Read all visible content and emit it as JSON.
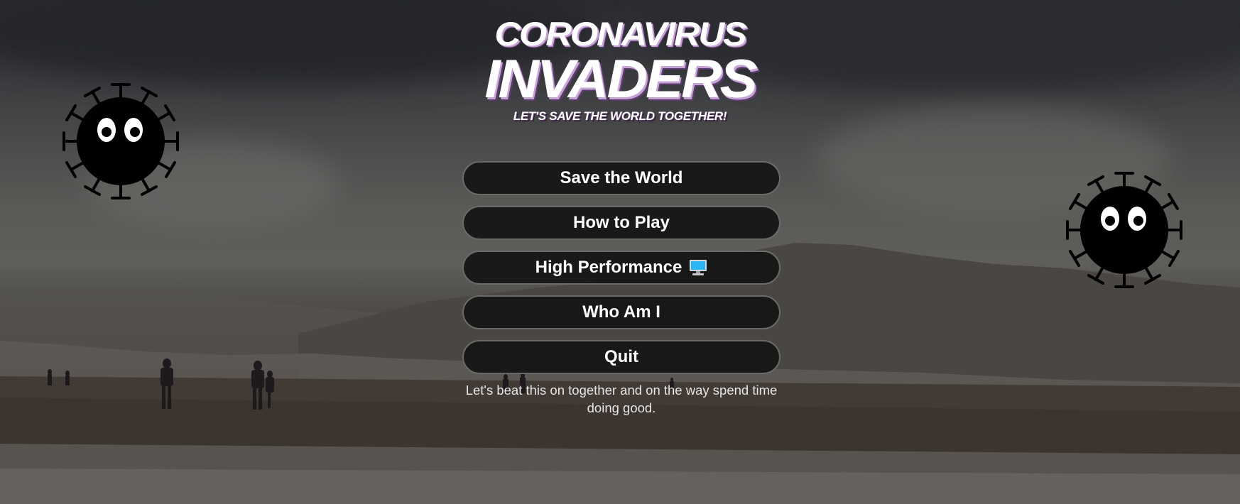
{
  "title": {
    "line1": "CORONAVIRUS",
    "line2": "INVADERS",
    "subtitle": "LET'S SAVE THE WORLD TOGETHER!"
  },
  "menu": {
    "items": [
      {
        "label": "Save the World",
        "icon": null
      },
      {
        "label": "How to Play",
        "icon": null
      },
      {
        "label": "High Performance",
        "icon": "computer-monitor-icon"
      },
      {
        "label": "Who Am I",
        "icon": null
      },
      {
        "label": "Quit",
        "icon": null
      }
    ]
  },
  "tagline": "Let's beat this on together and on the way spend time doing good.",
  "colors": {
    "button_bg": "#141414",
    "button_border": "#6a6a6a",
    "title_shadow": "#c7a4d6",
    "virus_body": "#000000",
    "monitor_screen": "#29b6f6"
  },
  "decorations": [
    "coronavirus-character-icon",
    "coronavirus-character-icon"
  ]
}
